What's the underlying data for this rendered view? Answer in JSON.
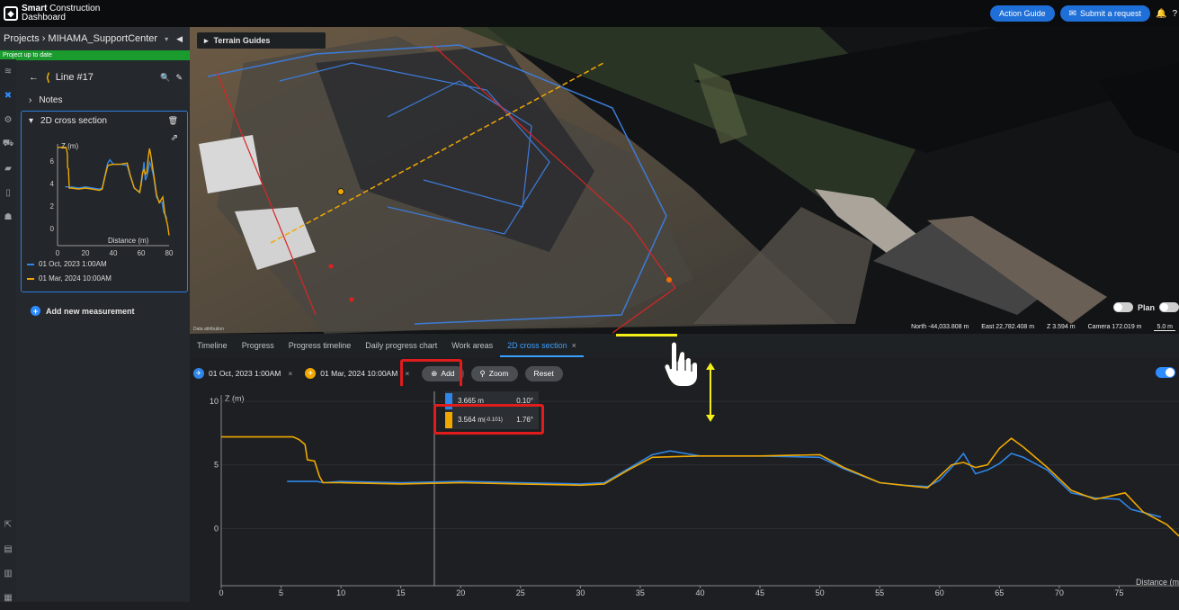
{
  "app": {
    "brand_bold": "Smart",
    "brand_rest": " Construction",
    "brand_line2": "Dashboard"
  },
  "topbar": {
    "action_guide": "Action Guide",
    "submit_request": "Submit a request"
  },
  "project": {
    "label": "Projects",
    "separator": "›",
    "name": "MIHAMA_SupportCenter",
    "status": "Project up to date"
  },
  "panel": {
    "line_title": "Line #17",
    "notes": "Notes",
    "cross_section_title": "2D cross section",
    "mini_chart": {
      "ylabel": "Z (m)",
      "xlabel": "Distance (m)",
      "yticks": [
        "6",
        "4",
        "2",
        "0"
      ],
      "xticks": [
        "0",
        "20",
        "40",
        "60",
        "80"
      ]
    },
    "legend": [
      {
        "label": "01 Oct, 2023 1:00AM",
        "color": "#2f86e8"
      },
      {
        "label": "01 Mar, 2024 10:00AM",
        "color": "#f0a800"
      }
    ],
    "add_measurement": "Add new measurement"
  },
  "viewport": {
    "terrain_guides": "Terrain Guides",
    "plan": "Plan",
    "north": "North -44,033.808 m",
    "east": "East 22,782.408 m",
    "z": "Z 3.594 m",
    "camera": "Camera 172.019 m",
    "scale": "5.0 m",
    "attribution": "Data attribution"
  },
  "tabs": [
    "Timeline",
    "Progress",
    "Progress timeline",
    "Daily progress chart",
    "Work areas",
    "2D cross section"
  ],
  "toolbar": {
    "chip1": "01 Oct, 2023 1:00AM",
    "chip2": "01 Mar, 2024 10:00AM",
    "add": "Add",
    "zoom": "Zoom",
    "reset": "Reset"
  },
  "tooltip": {
    "row1_value": "3.665 m",
    "row1_angle": "0.10°",
    "row2_value": "3.564 m",
    "row2_delta": "(-0.101)",
    "row2_angle": "1.76°"
  },
  "chart_data": {
    "type": "line",
    "ylabel": "Z (m)",
    "xlabel": "Distance (m",
    "yticks": [
      10,
      5,
      0
    ],
    "xticks": [
      0,
      5,
      10,
      15,
      20,
      25,
      30,
      35,
      40,
      45,
      50,
      55,
      60,
      65,
      70,
      75
    ],
    "xlim": [
      0,
      80
    ],
    "ylim": [
      -4.5,
      10.5
    ],
    "cursor_x": 17.8,
    "series": [
      {
        "name": "01 Oct, 2023 1:00AM",
        "color": "#2f86e8",
        "x": [
          5.5,
          8,
          8.5,
          10,
          15,
          20,
          25,
          30,
          32,
          34,
          36,
          37.5,
          40,
          45,
          50,
          52,
          55,
          57,
          59,
          60,
          61,
          62,
          63,
          64,
          65,
          66,
          67,
          69,
          71,
          73,
          75,
          76,
          78.5
        ],
        "y": [
          3.7,
          3.7,
          3.6,
          3.7,
          3.6,
          3.7,
          3.6,
          3.5,
          3.6,
          4.7,
          5.8,
          6.1,
          5.7,
          5.7,
          5.6,
          4.7,
          3.6,
          3.4,
          3.3,
          3.8,
          4.8,
          5.9,
          4.3,
          4.6,
          5.1,
          5.9,
          5.6,
          4.6,
          2.8,
          2.4,
          2.3,
          1.5,
          0.9
        ]
      },
      {
        "name": "01 Mar, 2024 10:00AM",
        "color": "#f0a800",
        "x": [
          0,
          3,
          6,
          6.5,
          7,
          7.2,
          7.8,
          8.2,
          8.5,
          10,
          15,
          20,
          25,
          30,
          32,
          34,
          36,
          40,
          45,
          50,
          52,
          55,
          59,
          60,
          61,
          62,
          63,
          64,
          65,
          66,
          67,
          69,
          71,
          73,
          74.5,
          75.5,
          77,
          79,
          80
        ],
        "y": [
          7.2,
          7.2,
          7.2,
          7.0,
          6.6,
          5.4,
          5.3,
          4.1,
          3.6,
          3.6,
          3.5,
          3.6,
          3.5,
          3.4,
          3.5,
          4.6,
          5.6,
          5.7,
          5.7,
          5.8,
          4.8,
          3.6,
          3.2,
          4.1,
          5.0,
          5.2,
          4.8,
          5.0,
          6.3,
          7.1,
          6.4,
          4.8,
          3.0,
          2.3,
          2.6,
          2.8,
          1.3,
          0.3,
          -0.6
        ]
      }
    ]
  }
}
